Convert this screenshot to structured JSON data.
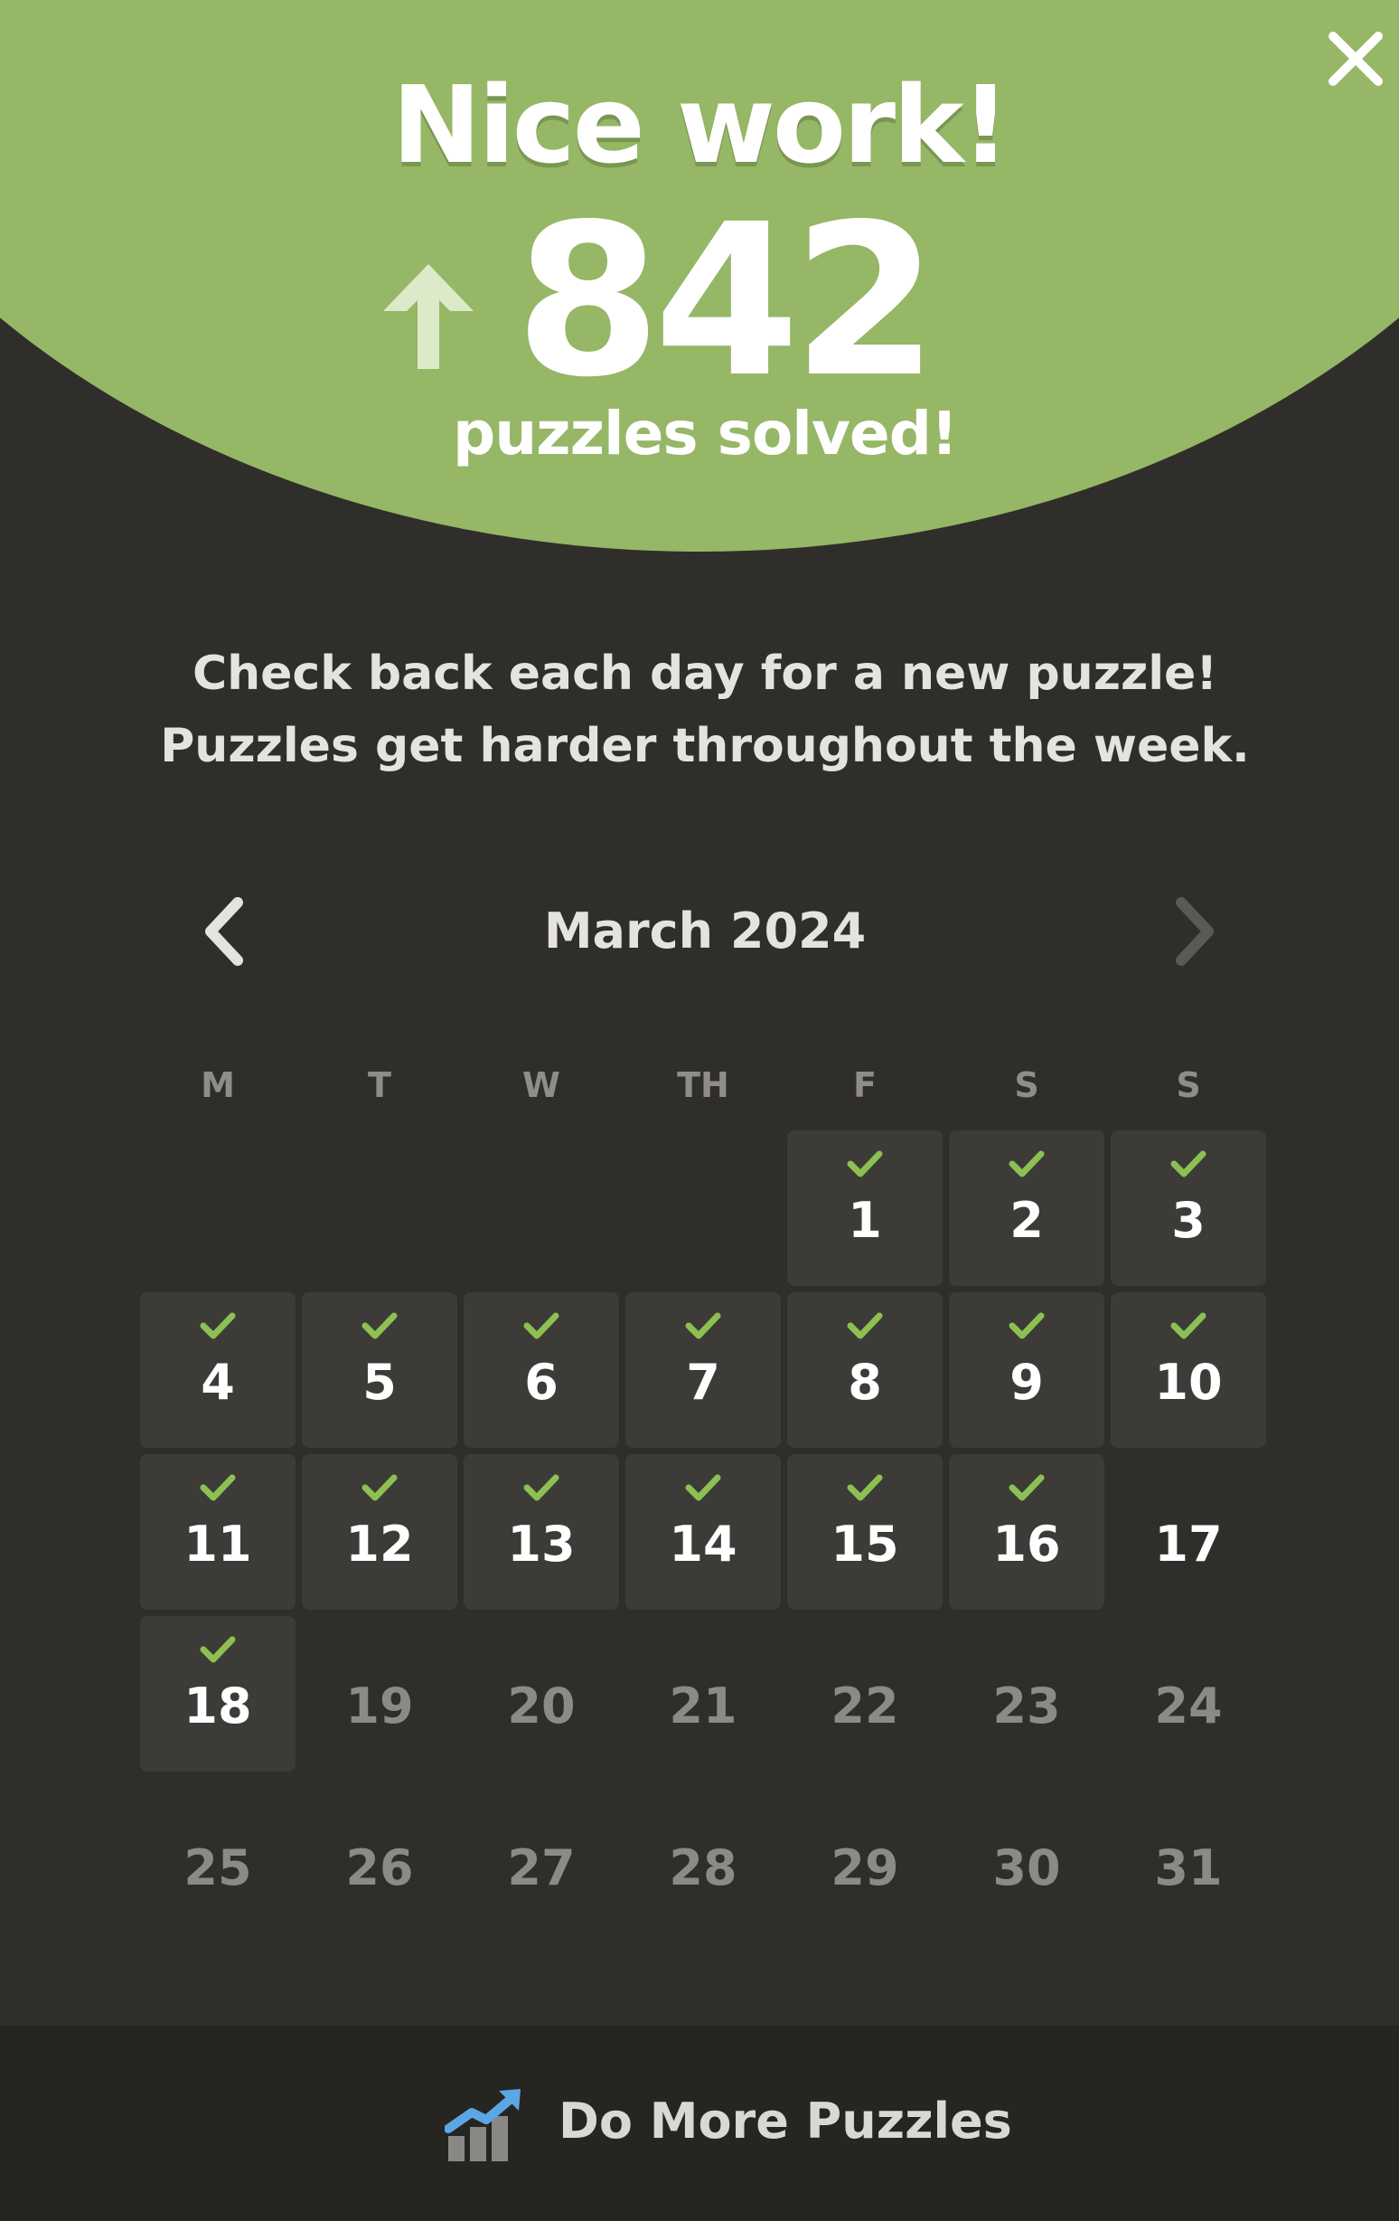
{
  "header": {
    "title": "Nice work!",
    "count": "842",
    "count_caption": "puzzles solved!",
    "close_icon": "close-icon",
    "arrow_icon": "arrow-up-icon"
  },
  "info": {
    "line1": "Check back each day for a new puzzle!",
    "line2": "Puzzles get harder throughout the week."
  },
  "calendar": {
    "month_label": "March 2024",
    "prev_icon": "chevron-left-icon",
    "next_icon": "chevron-right-icon",
    "weekdays": [
      "M",
      "T",
      "W",
      "TH",
      "F",
      "S",
      "S"
    ],
    "first_weekday_index": 4,
    "days": [
      {
        "day": "1",
        "status": "solved"
      },
      {
        "day": "2",
        "status": "solved"
      },
      {
        "day": "3",
        "status": "solved"
      },
      {
        "day": "4",
        "status": "solved"
      },
      {
        "day": "5",
        "status": "solved"
      },
      {
        "day": "6",
        "status": "solved"
      },
      {
        "day": "7",
        "status": "solved"
      },
      {
        "day": "8",
        "status": "solved"
      },
      {
        "day": "9",
        "status": "solved"
      },
      {
        "day": "10",
        "status": "solved"
      },
      {
        "day": "11",
        "status": "solved"
      },
      {
        "day": "12",
        "status": "solved"
      },
      {
        "day": "13",
        "status": "solved"
      },
      {
        "day": "14",
        "status": "solved"
      },
      {
        "day": "15",
        "status": "solved"
      },
      {
        "day": "16",
        "status": "solved"
      },
      {
        "day": "17",
        "status": "unsolved"
      },
      {
        "day": "18",
        "status": "solved"
      },
      {
        "day": "19",
        "status": "future"
      },
      {
        "day": "20",
        "status": "future"
      },
      {
        "day": "21",
        "status": "future"
      },
      {
        "day": "22",
        "status": "future"
      },
      {
        "day": "23",
        "status": "future"
      },
      {
        "day": "24",
        "status": "future"
      },
      {
        "day": "25",
        "status": "future"
      },
      {
        "day": "26",
        "status": "future"
      },
      {
        "day": "27",
        "status": "future"
      },
      {
        "day": "28",
        "status": "future"
      },
      {
        "day": "29",
        "status": "future"
      },
      {
        "day": "30",
        "status": "future"
      },
      {
        "day": "31",
        "status": "future"
      }
    ]
  },
  "footer": {
    "label": "Do More Puzzles",
    "icon": "rising-chart-icon"
  },
  "colors": {
    "accent_green": "#95b766",
    "check_green": "#8cc152",
    "background": "#302e2b",
    "cell_solved": "#3d3b38",
    "footer_bg": "#262522"
  }
}
